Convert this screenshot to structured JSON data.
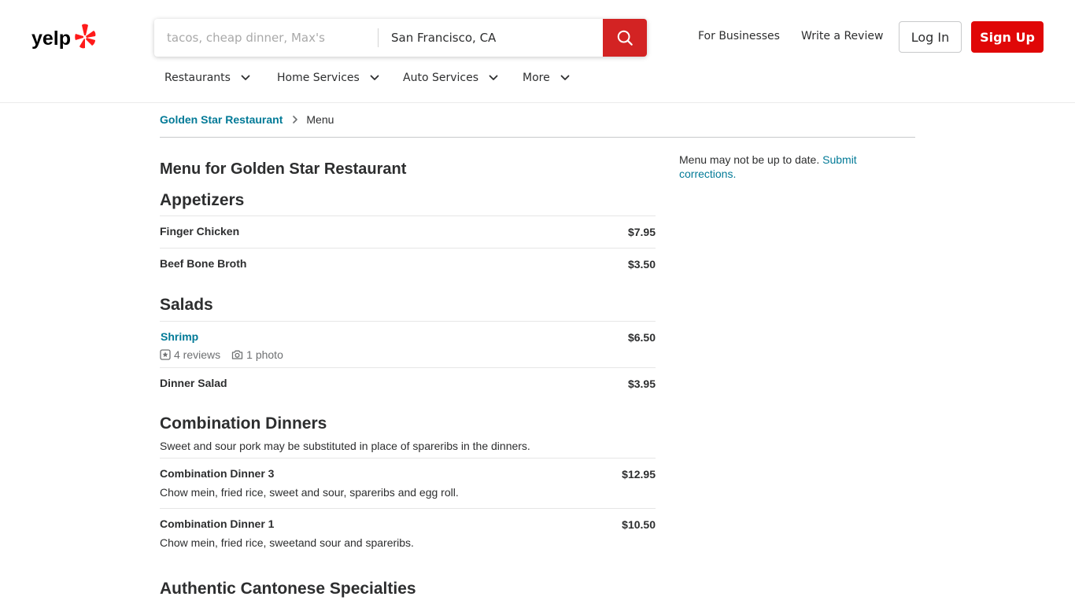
{
  "header": {
    "search_find_placeholder": "tacos, cheap dinner, Max's",
    "search_location_value": "San Francisco, CA",
    "for_businesses": "For Businesses",
    "write_review": "Write a Review",
    "login": "Log In",
    "signup": "Sign Up",
    "nav": [
      "Restaurants",
      "Home Services",
      "Auto Services",
      "More"
    ],
    "brand_color": "#d32323"
  },
  "breadcrumb": {
    "business": "Golden Star Restaurant",
    "current": "Menu"
  },
  "page_title": "Menu for Golden Star Restaurant",
  "sidebar": {
    "note_text": "Menu may not be up to date.",
    "note_link": "Submit corrections."
  },
  "sections": [
    {
      "title": "Appetizers",
      "items": [
        {
          "name": "Finger Chicken",
          "price": "$7.95"
        },
        {
          "name": "Beef Bone Broth",
          "price": "$3.50"
        }
      ]
    },
    {
      "title": "Salads",
      "items": [
        {
          "name": "Shrimp",
          "price": "$6.50",
          "reviews": "4 reviews",
          "photos": "1 photo"
        },
        {
          "name": "Dinner Salad",
          "price": "$3.95"
        }
      ]
    },
    {
      "title": "Combination Dinners",
      "note": "Sweet and sour pork may be substituted in place of spareribs in the dinners.",
      "items": [
        {
          "name": "Combination Dinner 3",
          "price": "$12.95",
          "desc": "Chow mein, fried rice, sweet and sour, spareribs and egg roll."
        },
        {
          "name": "Combination Dinner 1",
          "price": "$10.50",
          "desc": "Chow mein, fried rice, sweetand sour and spareribs."
        }
      ]
    },
    {
      "title": "Authentic Cantonese Specialties"
    }
  ]
}
